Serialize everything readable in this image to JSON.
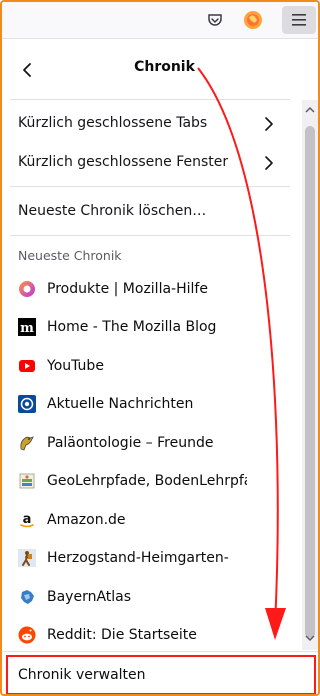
{
  "toolbar": {
    "pocket_icon": "pocket-icon",
    "profile_icon": "firefox-account-icon",
    "menu_icon": "hamburger-menu-icon"
  },
  "panel": {
    "title": "Chronik",
    "back_icon": "chevron-left-icon"
  },
  "sub_items": [
    {
      "label": "Kürzlich geschlossene Tabs",
      "icon": "chevron-right-icon"
    },
    {
      "label": "Kürzlich geschlossene Fenster",
      "icon": "chevron-right-icon"
    }
  ],
  "clear_label": "Neueste Chronik löschen…",
  "recent_title": "Neueste Chronik",
  "history": [
    {
      "label": "Produkte | Mozilla-Hilfe",
      "icon": "mozilla-support-icon"
    },
    {
      "label": "Home - The Mozilla Blog",
      "icon": "mozilla-m-icon"
    },
    {
      "label": "YouTube",
      "icon": "youtube-icon"
    },
    {
      "label": "Aktuelle Nachrichten",
      "icon": "tagesschau-icon"
    },
    {
      "label": "Paläontologie – Freunde",
      "icon": "paleontology-icon"
    },
    {
      "label": "GeoLehrpfade, BodenLehrpfade",
      "icon": "geolehrpfade-icon"
    },
    {
      "label": "Amazon.de",
      "icon": "amazon-icon"
    },
    {
      "label": "Herzogstand-Heimgarten-",
      "icon": "hiking-icon"
    },
    {
      "label": "BayernAtlas",
      "icon": "bayern-atlas-icon"
    },
    {
      "label": "Reddit: Die Startseite",
      "icon": "reddit-icon"
    }
  ],
  "footer": {
    "manage_label": "Chronik verwalten"
  },
  "colors": {
    "annotation_red": "#ff1a1a",
    "window_border": "#f28a1c"
  }
}
